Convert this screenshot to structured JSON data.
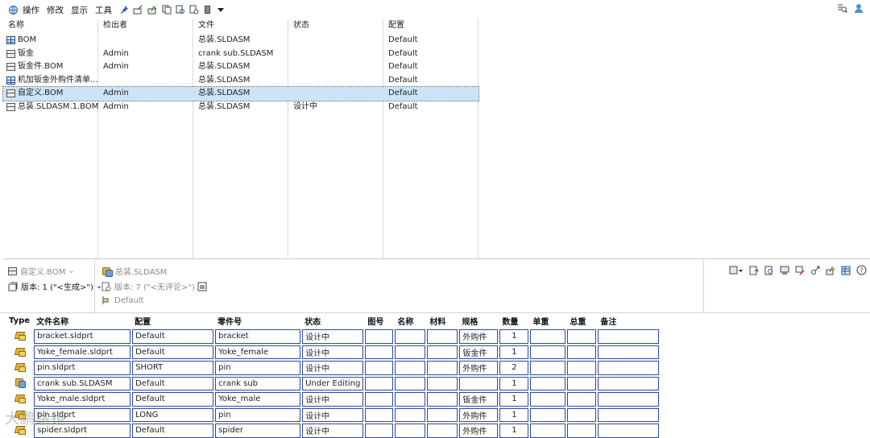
{
  "toolbar": {
    "menus": [
      "操作",
      "修改",
      "显示",
      "工具"
    ]
  },
  "upper_list": {
    "columns": [
      "名称",
      "检出者",
      "文件",
      "状态",
      "配置"
    ],
    "rows": [
      {
        "name": "BOM",
        "icon": "bom-table-icon",
        "user": "",
        "file": "总装.SLDASM",
        "state": "",
        "config": "Default"
      },
      {
        "name": "钣金",
        "icon": "sheet-bom-icon",
        "user": "Admin",
        "file": "crank sub.SLDASM",
        "state": "",
        "config": "Default"
      },
      {
        "name": "钣金件.BOM",
        "icon": "sheet-bom-icon",
        "user": "Admin",
        "file": "总装.SLDASM",
        "state": "",
        "config": "Default"
      },
      {
        "name": "机加钣金外购件清单...",
        "icon": "bom-table-icon",
        "user": "",
        "file": "总装.SLDASM",
        "state": "",
        "config": "Default"
      },
      {
        "name": "自定义.BOM",
        "icon": "sheet-bom-icon",
        "user": "Admin",
        "file": "总装.SLDASM",
        "state": "",
        "config": "Default",
        "selected": true
      },
      {
        "name": "总装.SLDASM.1.BOM",
        "icon": "sheet-bom-icon",
        "user": "Admin",
        "file": "总装.SLDASM",
        "state": "设计中",
        "config": "Default"
      }
    ]
  },
  "info": {
    "bom_name": "自定义.BOM",
    "bom_version": "版本: 1 (\"<生成>\")",
    "source_file": "总装.SLDASM",
    "file_version": "版本: 7 (\"<无评论>\")",
    "config": "Default"
  },
  "bom_table": {
    "headers": [
      "Type",
      "文件名称",
      "配置",
      "零件号",
      "状态",
      "图号",
      "名称",
      "材料",
      "规格",
      "数量",
      "单重",
      "总重",
      "备注"
    ],
    "rows": [
      {
        "type": "part",
        "file": "bracket.sldprt",
        "config": "Default",
        "part_no": "bracket",
        "state": "设计中",
        "drawing_no": "",
        "name": "",
        "material": "",
        "spec": "外购件",
        "qty": "1",
        "unit_weight": "",
        "total_weight": "",
        "note": ""
      },
      {
        "type": "part",
        "file": "Yoke_female.sldprt",
        "config": "Default",
        "part_no": "Yoke_female",
        "state": "设计中",
        "drawing_no": "",
        "name": "",
        "material": "",
        "spec": "钣金件",
        "qty": "1",
        "unit_weight": "",
        "total_weight": "",
        "note": ""
      },
      {
        "type": "part",
        "file": "pin.sldprt",
        "config": "SHORT",
        "part_no": "pin",
        "state": "设计中",
        "drawing_no": "",
        "name": "",
        "material": "",
        "spec": "外购件",
        "qty": "2",
        "unit_weight": "",
        "total_weight": "",
        "note": ""
      },
      {
        "type": "assembly",
        "file": "crank sub.SLDASM",
        "config": "Default",
        "part_no": "crank sub",
        "state": "Under Editing",
        "drawing_no": "",
        "name": "",
        "material": "",
        "spec": "",
        "qty": "1",
        "unit_weight": "",
        "total_weight": "",
        "note": ""
      },
      {
        "type": "part",
        "file": "Yoke_male.sldprt",
        "config": "Default",
        "part_no": "Yoke_male",
        "state": "设计中",
        "drawing_no": "",
        "name": "",
        "material": "",
        "spec": "钣金件",
        "qty": "1",
        "unit_weight": "",
        "total_weight": "",
        "note": ""
      },
      {
        "type": "part",
        "file": "pin.sldprt",
        "config": "LONG",
        "part_no": "pin",
        "state": "设计中",
        "drawing_no": "",
        "name": "",
        "material": "",
        "spec": "外购件",
        "qty": "1",
        "unit_weight": "",
        "total_weight": "",
        "note": ""
      },
      {
        "type": "part",
        "file": "spider.sldprt",
        "config": "Default",
        "part_no": "spider",
        "state": "设计中",
        "drawing_no": "",
        "name": "",
        "material": "",
        "spec": "外购件",
        "qty": "1",
        "unit_weight": "",
        "total_weight": "",
        "note": ""
      }
    ]
  },
  "watermark": "大鹏路镜"
}
